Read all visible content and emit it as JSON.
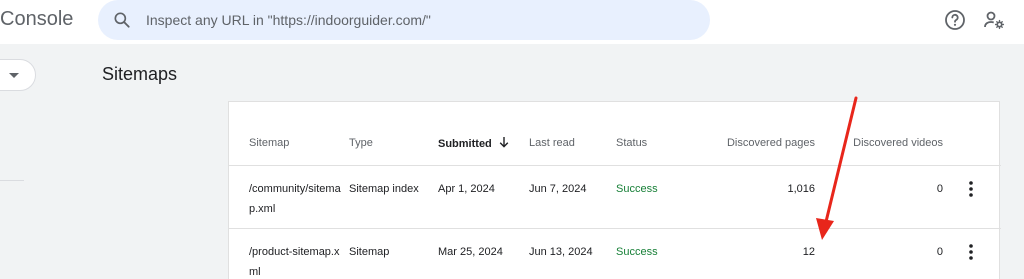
{
  "app": {
    "brand_title": "Console"
  },
  "search": {
    "placeholder": "Inspect any URL in \"https://indoorguider.com/\""
  },
  "page": {
    "title": "Sitemaps"
  },
  "table": {
    "headers": {
      "sitemap": "Sitemap",
      "type": "Type",
      "submitted": "Submitted",
      "last_read": "Last read",
      "status": "Status",
      "discovered_pages": "Discovered pages",
      "discovered_videos": "Discovered videos"
    },
    "rows": [
      {
        "sitemap_line1": "/community/sitema",
        "sitemap_line2": "p.xml",
        "type": "Sitemap index",
        "submitted": "Apr 1, 2024",
        "last_read": "Jun 7, 2024",
        "status": "Success",
        "discovered_pages": "1,016",
        "discovered_videos": "0"
      },
      {
        "sitemap_line1": "/product-sitemap.x",
        "sitemap_line2": "ml",
        "type": "Sitemap",
        "submitted": "Mar 25, 2024",
        "last_read": "Jun 13, 2024",
        "status": "Success",
        "discovered_pages": "12",
        "discovered_videos": "0"
      }
    ]
  },
  "colors": {
    "success": "#188038",
    "annotation": "#e8261b",
    "search_bg": "#e8f0fe"
  },
  "icons": {
    "search": "search-icon",
    "help": "help-icon",
    "account": "account-settings-icon",
    "sort": "arrow-down-icon",
    "more": "more-vert-icon"
  }
}
